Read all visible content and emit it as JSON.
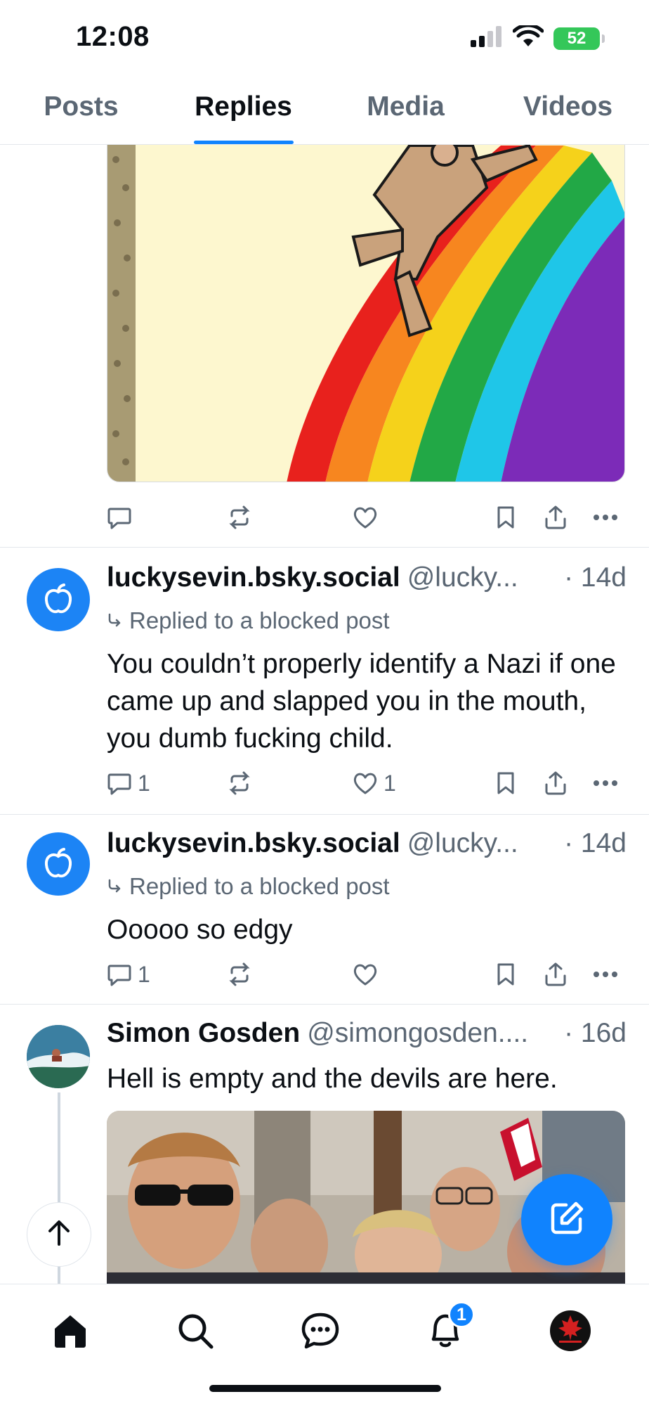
{
  "status_bar": {
    "time": "12:08",
    "battery": "52"
  },
  "tabs": [
    {
      "label": "Posts"
    },
    {
      "label": "Replies"
    },
    {
      "label": "Media"
    },
    {
      "label": "Videos"
    }
  ],
  "active_tab": "Replies",
  "posts": [
    {
      "author": "luckysevin.bsky.social",
      "handle": "@lucky...",
      "time": "· 14d",
      "reply_note": "Replied to a blocked post",
      "text": "You couldn’t properly identify a Nazi if one came up and slapped you in the mouth, you dumb fucking child.",
      "reply_count": "1",
      "like_count": "1"
    },
    {
      "author": "luckysevin.bsky.social",
      "handle": "@lucky...",
      "time": "· 14d",
      "reply_note": "Replied to a blocked post",
      "text": "Ooooo so edgy",
      "reply_count": "1",
      "like_count": ""
    },
    {
      "author": "Simon Gosden",
      "handle": "@simongosden....",
      "time": "· 16d",
      "text": "Hell is empty and the devils are here."
    }
  ],
  "bottom_nav": {
    "notifications_badge": "1"
  },
  "colors": {
    "accent": "#1083fe",
    "muted": "#5b6774",
    "divider": "#e3e7ec",
    "battery": "#34c759"
  },
  "icons": [
    "signal-icon",
    "wifi-icon",
    "battery-icon",
    "reply-icon",
    "repost-icon",
    "like-icon",
    "bookmark-icon",
    "share-icon",
    "more-icon",
    "reply-arrow-icon",
    "arrow-up-icon",
    "compose-icon",
    "home-icon",
    "search-icon",
    "chat-icon",
    "bell-icon"
  ]
}
